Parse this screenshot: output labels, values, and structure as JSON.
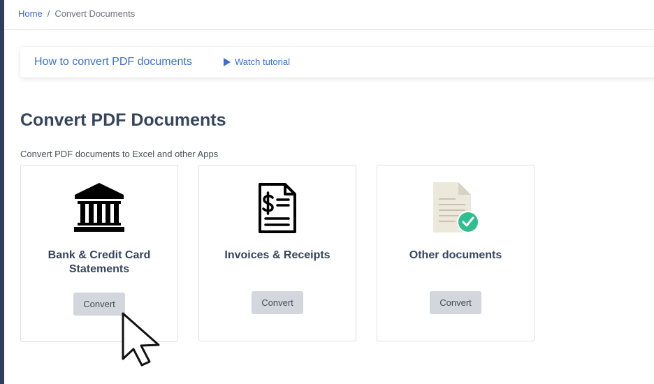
{
  "breadcrumb": {
    "home": "Home",
    "separator": "/",
    "current": "Convert Documents"
  },
  "tutorial": {
    "title": "How to convert PDF documents",
    "watch_label": "Watch tutorial",
    "icon": "play-icon"
  },
  "page": {
    "title": "Convert PDF Documents",
    "subtitle": "Convert PDF documents to Excel and other Apps"
  },
  "cards": [
    {
      "title": "Bank & Credit Card Statements",
      "icon": "bank-icon",
      "button": "Convert"
    },
    {
      "title": "Invoices & Receipts",
      "icon": "invoice-icon",
      "button": "Convert"
    },
    {
      "title": "Other documents",
      "icon": "document-check-icon",
      "button": "Convert"
    }
  ],
  "colors": {
    "link": "#3a6fd0",
    "title": "#36455e",
    "button_bg": "#d3d6dc",
    "check_badge": "#2fbf8f",
    "rail": "#2e3e58"
  },
  "cursor": "mouse-pointer-icon"
}
